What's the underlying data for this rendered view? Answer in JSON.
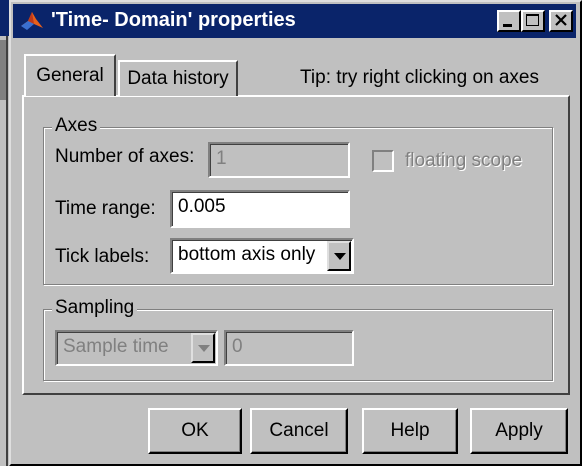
{
  "window": {
    "title": "'Time- Domain' properties"
  },
  "tabs": [
    {
      "label": "General",
      "selected": true
    },
    {
      "label": "Data history",
      "selected": false
    }
  ],
  "tip": "Tip: try right clicking on axes",
  "axes": {
    "group_label": "Axes",
    "number_of_axes_label": "Number of axes:",
    "number_of_axes_value": "1",
    "floating_scope_label": "floating scope",
    "time_range_label": "Time range:",
    "time_range_value": "0.005",
    "tick_labels_label": "Tick labels:",
    "tick_labels_value": "bottom axis only"
  },
  "sampling": {
    "group_label": "Sampling",
    "mode_value": "Sample time",
    "value": "0"
  },
  "buttons": {
    "ok": "OK",
    "cancel": "Cancel",
    "help": "Help",
    "apply": "Apply"
  },
  "colors": {
    "titlebar": "#0a246a",
    "face": "#c0c0c0",
    "disabled_text": "#808080"
  },
  "icons": {
    "app": "matlab-logo-icon",
    "dropdown": "chevron-down-icon"
  }
}
